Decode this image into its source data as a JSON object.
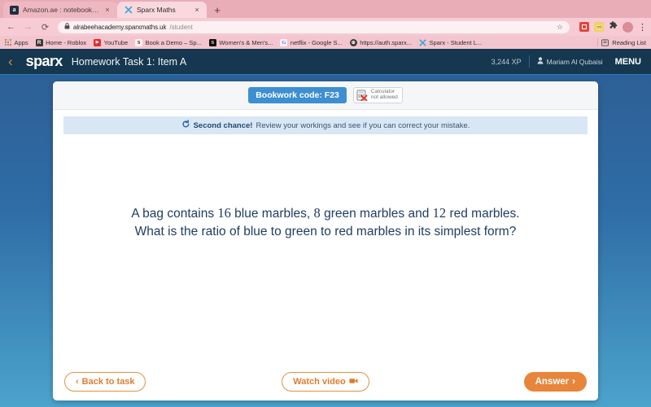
{
  "browser": {
    "tabs": [
      {
        "title": "Amazon.ae : notebook graph n...",
        "favicon": "amazon-icon",
        "active": false,
        "close_label": "×"
      },
      {
        "title": "Sparx Maths",
        "favicon": "sparx-icon",
        "active": true,
        "close_label": "×"
      }
    ],
    "new_tab_label": "+",
    "nav": {
      "back_label": "←",
      "forward_label": "→",
      "reload_label": "⟳",
      "lock_label": "🔒",
      "url_host": "alrabeehacademy.sparxmaths.uk",
      "url_path": "/student",
      "star_label": "☆",
      "puzzle_label": "🧩",
      "kebab_label": "⋮"
    },
    "bookmarks": [
      {
        "label": "Apps",
        "icon": "apps-grid-icon"
      },
      {
        "label": "Home - Roblox",
        "icon": "roblox-icon",
        "glyph": "R"
      },
      {
        "label": "YouTube",
        "icon": "youtube-icon",
        "glyph": "▶"
      },
      {
        "label": "Book a Demo – Sp...",
        "icon": "sparx-s-icon",
        "glyph": "S"
      },
      {
        "label": "Women's & Men's...",
        "icon": "shein-s-icon",
        "glyph": "S"
      },
      {
        "label": "netflix - Google S...",
        "icon": "google-g-icon",
        "glyph": "G"
      },
      {
        "label": "https://auth.sparx...",
        "icon": "globe-icon",
        "glyph": "⊕"
      },
      {
        "label": "Sparx - Student L...",
        "icon": "sparx-x-icon",
        "glyph": "X"
      }
    ],
    "reading_list": {
      "label": "Reading List",
      "icon": "reading-list-icon"
    }
  },
  "app": {
    "back_label": "‹",
    "brand": "sparx",
    "task_title": "Homework Task 1: Item A",
    "xp": "3,244 XP",
    "user_name": "Mariam Al Qubaisi",
    "menu_label": "MENU",
    "accent_orange": "#e8853a",
    "header_bg": "#153750"
  },
  "card": {
    "bookwork_code": "Bookwork code: F23",
    "calculator": {
      "line1": "Calculator",
      "line2": "not allowed"
    },
    "banner": {
      "bold": "Second chance!",
      "rest": " Review your workings and see if you can correct your mistake.",
      "icon": "retry-arrow-icon"
    },
    "question": {
      "line1_a": "A bag contains ",
      "line1_n1": "16",
      "line1_b": " blue marbles, ",
      "line1_n2": "8",
      "line1_c": " green marbles and ",
      "line1_n3": "12",
      "line1_d": " red marbles.",
      "line2": "What is the ratio of blue to green to red marbles in its simplest form?"
    },
    "footer": {
      "back_to_task": "Back to task",
      "back_chevron": "‹",
      "watch_video": "Watch video",
      "video_icon": "video-camera-icon",
      "answer": "Answer",
      "answer_chevron": "›"
    }
  }
}
